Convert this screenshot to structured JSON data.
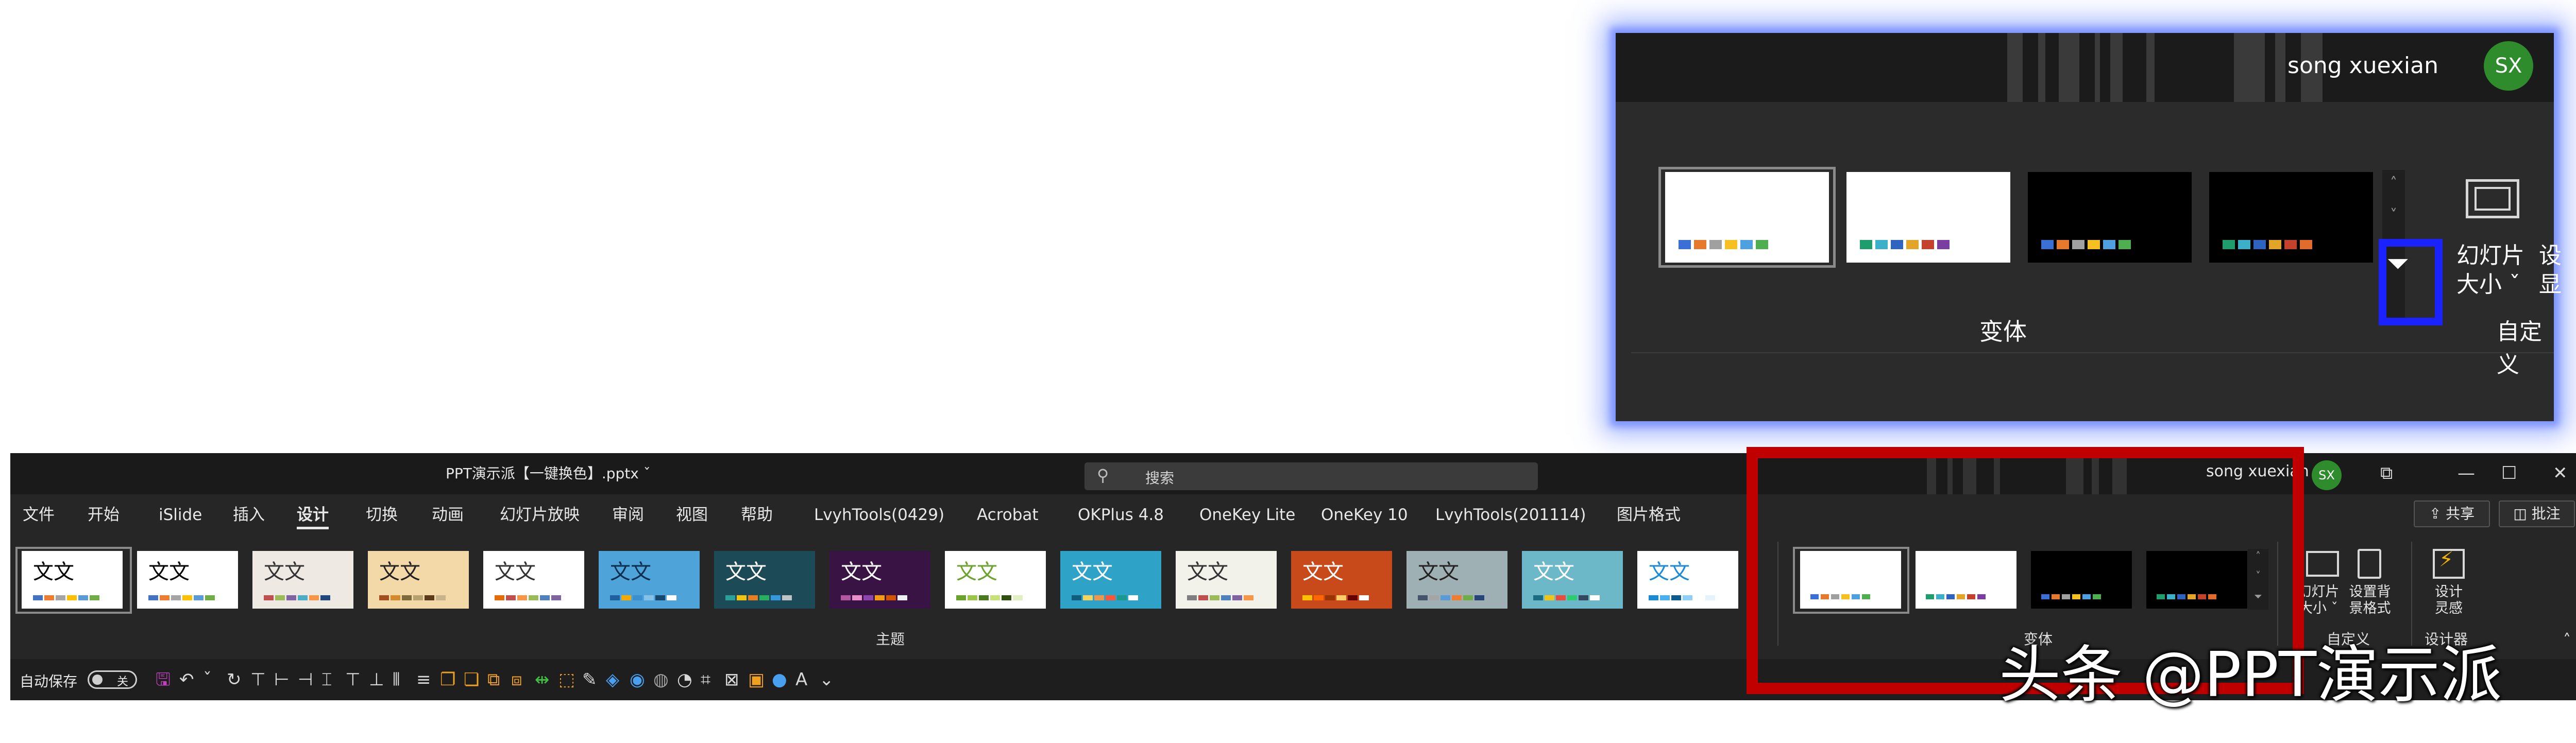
{
  "zoom_inset": {
    "user_name": "song xuexian",
    "avatar_initials": "SX",
    "group_label": "变体",
    "slide_size_label_1": "幻灯片",
    "slide_size_label_2": "大小 ˇ",
    "cut_label_1": "设",
    "cut_label_2": "显",
    "custom_group_label": "自定义",
    "more_glyph": "⏷",
    "scroll_up_glyph": "˄",
    "scroll_down_glyph": "˅",
    "highlight_color": "#1a22ff",
    "variants": [
      {
        "bg": "#ffffff",
        "swatches": [
          "#3b6fd6",
          "#e6792b",
          "#a0a0a0",
          "#f5c020",
          "#4ea0e0",
          "#4fae4f"
        ]
      },
      {
        "bg": "#ffffff",
        "swatches": [
          "#1f9d6c",
          "#3ab1c8",
          "#2f63c0",
          "#e2a52a",
          "#c4412b",
          "#7a3ea1"
        ]
      },
      {
        "bg": "#000000",
        "swatches": [
          "#3b6fd6",
          "#e6792b",
          "#a0a0a0",
          "#f5c020",
          "#4ea0e0",
          "#4fae4f"
        ]
      },
      {
        "bg": "#000000",
        "swatches": [
          "#1f9d6c",
          "#3ab1c8",
          "#2f63c0",
          "#e2a52a",
          "#c4412b",
          "#e06b2a"
        ]
      }
    ]
  },
  "window": {
    "doc_title": "PPT演示派【一键换色】.pptx ˇ",
    "search_placeholder": "搜索",
    "search_icon": "magnifier-icon",
    "user_name": "song xuexian",
    "avatar_initials": "SX",
    "controls": {
      "restore_ribbon": "⧉",
      "minimize": "—",
      "maximize": "☐",
      "close": "✕"
    }
  },
  "ribbon": {
    "tabs": [
      "文件",
      "开始",
      "iSlide",
      "插入",
      "设计",
      "切换",
      "动画",
      "幻灯片放映",
      "审阅",
      "视图",
      "帮助",
      "LvyhTools(0429)",
      "Acrobat",
      "OKPlus 4.8",
      "OneKey Lite",
      "OneKey 10",
      "LvyhTools(201114)",
      "图片格式"
    ],
    "active_tab": "设计",
    "share_label": "⇪ 共享",
    "comment_label": "◫ 批注",
    "themes_group_label": "主题",
    "variants_group_label": "变体",
    "customize_group_label": "自定义",
    "designer_group_label": "设计器",
    "slide_size": {
      "line1": "幻灯片",
      "line2": "大小 ˇ"
    },
    "format_bg": {
      "line1": "设置背",
      "line2": "景格式"
    },
    "design_ideas": {
      "line1": "设计",
      "line2": "灵感"
    },
    "collapse_glyph": "˄",
    "themes": [
      {
        "text": "文文",
        "bg": "#ffffff",
        "fg": "#000000",
        "dots": [
          "#4472c4",
          "#ed7d31",
          "#a5a5a5",
          "#ffc000",
          "#5b9bd5",
          "#70ad47"
        ]
      },
      {
        "text": "文文",
        "bg": "#ffffff",
        "fg": "#000000",
        "dots": [
          "#4472c4",
          "#ed7d31",
          "#a5a5a5",
          "#ffc000",
          "#5b9bd5",
          "#70ad47"
        ]
      },
      {
        "text": "文文",
        "bg": "#efe9e4",
        "fg": "#333333",
        "dots": [
          "#c0504d",
          "#9bbb59",
          "#8064a2",
          "#4bacc6",
          "#f79646",
          "#1f497d"
        ]
      },
      {
        "text": "文文",
        "bg": "#f3d8a8",
        "fg": "#222222",
        "dots": [
          "#a34f1f",
          "#d38a2c",
          "#7e6a3a",
          "#b5a26e",
          "#5a3a1a",
          "#c8b48c"
        ]
      },
      {
        "text": "文文",
        "bg": "#ffffff",
        "fg": "#333333",
        "dots": [
          "#e36c09",
          "#c0504d",
          "#f79646",
          "#9bbb59",
          "#4f81bd",
          "#8064a2"
        ]
      },
      {
        "text": "文文",
        "bg": "#4ea3d8",
        "fg": "#0c2e4e",
        "dots": [
          "#1f5fa0",
          "#f2a900",
          "#3a8fd0",
          "#85c1e9",
          "#16486e",
          "#fefefe"
        ]
      },
      {
        "text": "文文",
        "bg": "#1d4a57",
        "fg": "#ffffff",
        "dots": [
          "#2aa198",
          "#f1c40f",
          "#e67e22",
          "#27ae60",
          "#3498db",
          "#bdc3c7"
        ]
      },
      {
        "text": "文文",
        "bg": "#3a1345",
        "fg": "#ffffff",
        "dots": [
          "#b1569f",
          "#e98dcb",
          "#8e44ad",
          "#f39c12",
          "#d35400",
          "#ecf0f1"
        ]
      },
      {
        "text": "文文",
        "bg": "#ffffff",
        "fg": "#6aa22b",
        "dots": [
          "#6aa22b",
          "#9bc64a",
          "#4a7a1f",
          "#c8e07a",
          "#2f5010",
          "#e2efc0"
        ]
      },
      {
        "text": "文文",
        "bg": "#2ea3c7",
        "fg": "#ffffff",
        "dots": [
          "#0f5e7e",
          "#f4d35e",
          "#ee964b",
          "#f95738",
          "#1b998b",
          "#ffffff"
        ]
      },
      {
        "text": "文文",
        "bg": "#f2f2ea",
        "fg": "#333333",
        "dots": [
          "#7f7f7f",
          "#c0504d",
          "#9bbb59",
          "#4f81bd",
          "#8064a2",
          "#f79646"
        ]
      },
      {
        "text": "文文",
        "bg": "#c84a1a",
        "fg": "#ffffff",
        "dots": [
          "#ffc000",
          "#ff6600",
          "#993300",
          "#ffcc66",
          "#660000",
          "#ffffff"
        ]
      },
      {
        "text": "文文",
        "bg": "#9fb0b5",
        "fg": "#222222",
        "dots": [
          "#44546a",
          "#a5a5a5",
          "#5b9bd5",
          "#ed7d31",
          "#70ad47",
          "#264478"
        ]
      },
      {
        "text": "文文",
        "bg": "#6cb8c9",
        "fg": "#ffffff",
        "dots": [
          "#1b6c80",
          "#f0c419",
          "#e94b3c",
          "#2ecc71",
          "#34495e",
          "#ffffff"
        ]
      },
      {
        "text": "文文",
        "bg": "#ffffff",
        "fg": "#1b8bd6",
        "dots": [
          "#1b8bd6",
          "#48b0f0",
          "#0f5a8e",
          "#8fd0f8",
          "#ffffff",
          "#e5f3fc"
        ]
      }
    ],
    "variants": [
      {
        "bg": "#ffffff",
        "swatches": [
          "#3b6fd6",
          "#e6792b",
          "#a0a0a0",
          "#f5c020",
          "#4ea0e0",
          "#4fae4f"
        ]
      },
      {
        "bg": "#ffffff",
        "swatches": [
          "#1f9d6c",
          "#3ab1c8",
          "#2f63c0",
          "#e2a52a",
          "#c4412b",
          "#7a3ea1"
        ]
      },
      {
        "bg": "#000000",
        "swatches": [
          "#3b6fd6",
          "#e6792b",
          "#a0a0a0",
          "#f5c020",
          "#4ea0e0",
          "#4fae4f"
        ]
      },
      {
        "bg": "#000000",
        "swatches": [
          "#1f9d6c",
          "#3ab1c8",
          "#2f63c0",
          "#e2a52a",
          "#c4412b",
          "#e06b2a"
        ]
      }
    ]
  },
  "qat": {
    "autosave_label": "自动保存",
    "autosave_state": "关",
    "icons": [
      {
        "name": "save-icon",
        "glyph": "🖫",
        "color": "#c040c0"
      },
      {
        "name": "undo-icon",
        "glyph": "↶",
        "color": "#d8d8d8"
      },
      {
        "name": "undo-dropdown-icon",
        "glyph": "ˇ",
        "color": "#d8d8d8"
      },
      {
        "name": "redo-icon",
        "glyph": "↻",
        "color": "#d8d8d8"
      },
      {
        "name": "align-top-icon",
        "glyph": "⊤",
        "color": "#d8d8d8"
      },
      {
        "name": "align-left-icon",
        "glyph": "⊢",
        "color": "#d8d8d8"
      },
      {
        "name": "align-right-icon",
        "glyph": "⊣",
        "color": "#d8d8d8"
      },
      {
        "name": "align-center-icon",
        "glyph": "⌶",
        "color": "#d8d8d8"
      },
      {
        "name": "align-middle-icon",
        "glyph": "⊤",
        "color": "#d8d8d8"
      },
      {
        "name": "align-bottom-icon",
        "glyph": "⊥",
        "color": "#d8d8d8"
      },
      {
        "name": "distribute-horizontal-icon",
        "glyph": "⫴",
        "color": "#d8d8d8"
      },
      {
        "name": "distribute-vertical-icon",
        "glyph": "≡",
        "color": "#d8d8d8"
      },
      {
        "name": "bring-forward-icon",
        "glyph": "❐",
        "color": "#f0a020"
      },
      {
        "name": "send-backward-icon",
        "glyph": "❏",
        "color": "#f0a020"
      },
      {
        "name": "group-icon",
        "glyph": "⧉",
        "color": "#f0a020"
      },
      {
        "name": "ungroup-icon",
        "glyph": "⧈",
        "color": "#f0a020"
      },
      {
        "name": "size-icon",
        "glyph": "⇹",
        "color": "#40c040"
      },
      {
        "name": "edit-shape-icon",
        "glyph": "⬚",
        "color": "#f0a020"
      },
      {
        "name": "edit-points-icon",
        "glyph": "✎",
        "color": "#d8d8d8"
      },
      {
        "name": "shape-fill-icon",
        "glyph": "◈",
        "color": "#4aa0f0"
      },
      {
        "name": "shape-outline-icon",
        "glyph": "◉",
        "color": "#4aa0f0"
      },
      {
        "name": "shape-effects-icon",
        "glyph": "◍",
        "color": "#a0a0a0"
      },
      {
        "name": "merge-shapes-icon",
        "glyph": "◔",
        "color": "#d8d8d8"
      },
      {
        "name": "crop-icon",
        "glyph": "⌗",
        "color": "#d8d8d8"
      },
      {
        "name": "picture-icon",
        "glyph": "⊠",
        "color": "#d8d8d8"
      },
      {
        "name": "selection-pane-icon",
        "glyph": "▣",
        "color": "#f0a020"
      },
      {
        "name": "circle-icon",
        "glyph": "●",
        "color": "#4aa0f0"
      },
      {
        "name": "font-color-icon",
        "glyph": "A",
        "color": "#d8d8d8"
      },
      {
        "name": "customize-qat-icon",
        "glyph": "⌄",
        "color": "#d8d8d8"
      }
    ]
  },
  "watermark": "头条 @PPT演示派"
}
